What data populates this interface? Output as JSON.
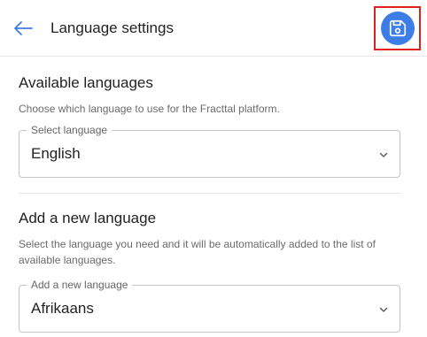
{
  "header": {
    "title": "Language settings",
    "back_icon": "arrow-left-icon",
    "save_icon": "save-icon",
    "accent_color": "#3d7de6",
    "highlight_color": "#e0221f"
  },
  "available": {
    "title": "Available languages",
    "description": "Choose which language to use for the Fracttal platform.",
    "select_label": "Select language",
    "select_value": "English"
  },
  "add_new": {
    "title": "Add a new language",
    "description": "Select the language you need and it will be automatically added to the list of available languages.",
    "select_label": "Add a new language",
    "select_value": "Afrikaans"
  }
}
